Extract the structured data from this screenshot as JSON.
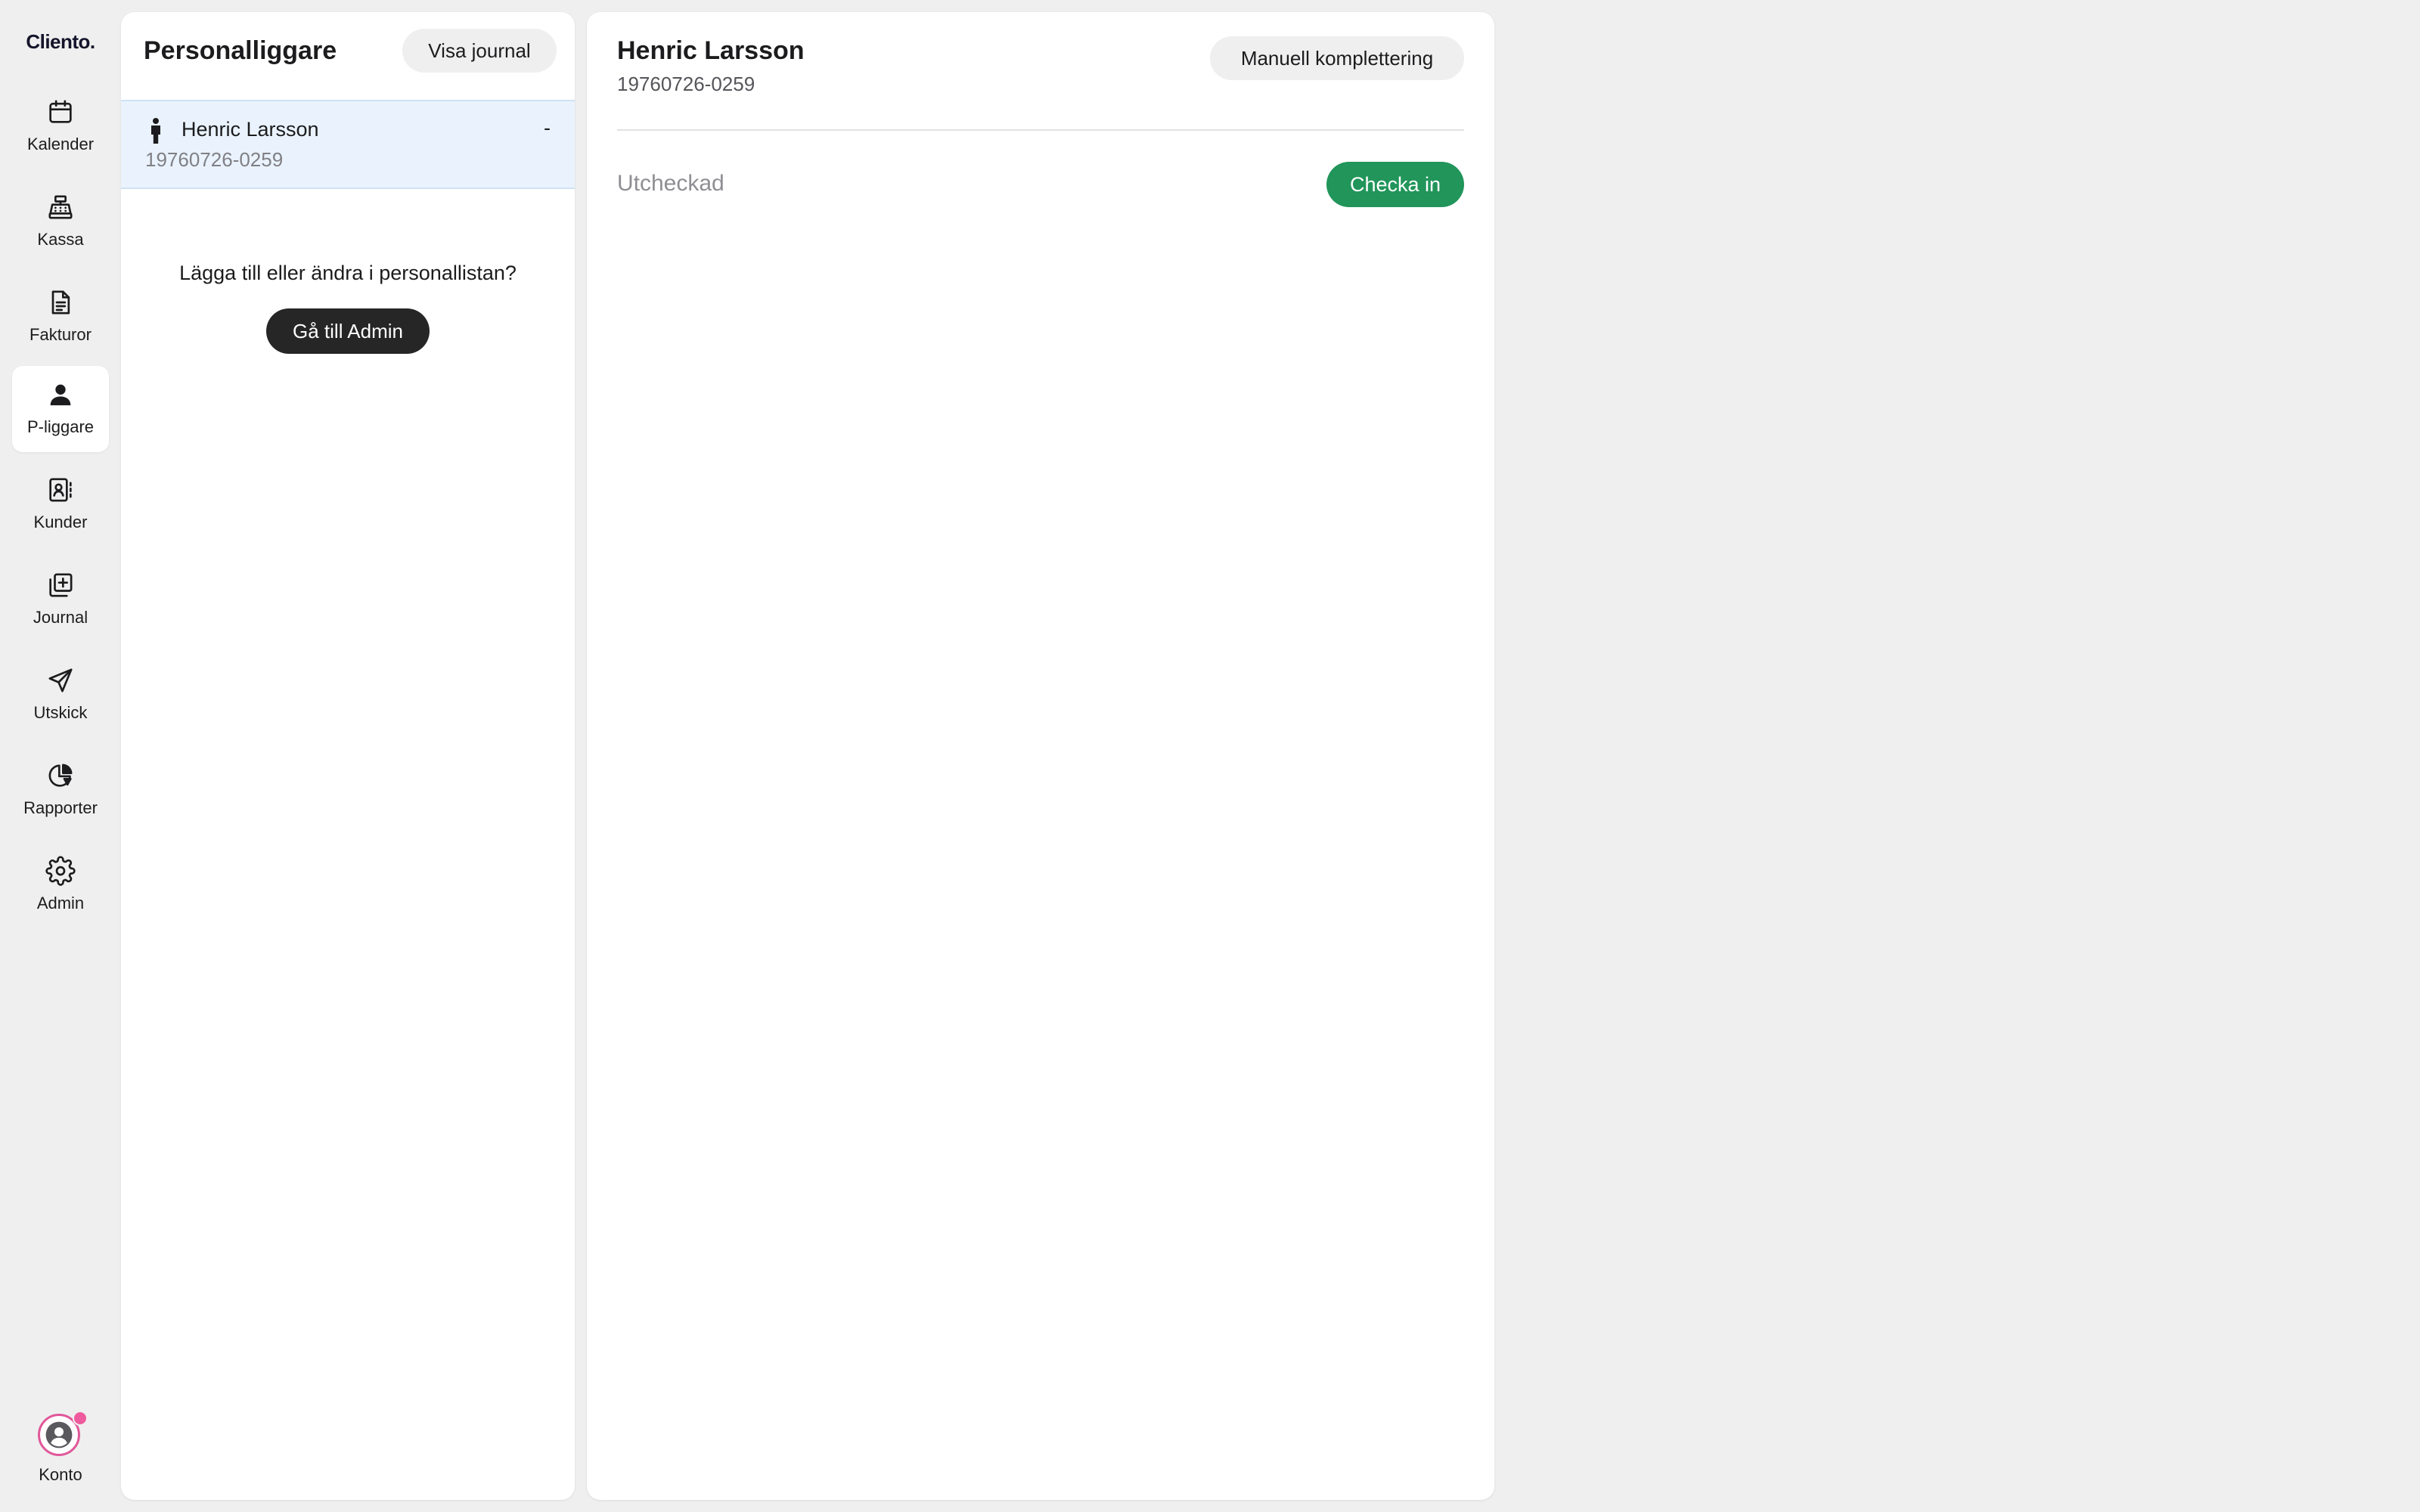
{
  "app": {
    "logo_text": "Cliento."
  },
  "sidebar": {
    "items": [
      {
        "label": "Kalender",
        "icon": "calendar-icon"
      },
      {
        "label": "Kassa",
        "icon": "cash-register-icon"
      },
      {
        "label": "Fakturor",
        "icon": "document-icon"
      },
      {
        "label": "P-liggare",
        "icon": "person-icon",
        "active": true
      },
      {
        "label": "Kunder",
        "icon": "contacts-icon"
      },
      {
        "label": "Journal",
        "icon": "journal-icon"
      },
      {
        "label": "Utskick",
        "icon": "send-icon"
      },
      {
        "label": "Rapporter",
        "icon": "pie-chart-icon"
      },
      {
        "label": "Admin",
        "icon": "gear-icon"
      }
    ],
    "account": {
      "label": "Konto",
      "icon": "user-avatar-icon",
      "has_notification": true
    }
  },
  "left_panel": {
    "title": "Personalliggare",
    "view_journal_label": "Visa journal",
    "employees": [
      {
        "name": "Henric Larsson",
        "id": "19760726-0259",
        "status": "-",
        "selected": true
      }
    ],
    "admin_prompt": "Lägga till eller ändra i personallistan?",
    "admin_button_label": "Gå till Admin"
  },
  "right_panel": {
    "name": "Henric Larsson",
    "id": "19760726-0259",
    "manual_button_label": "Manuell komplettering",
    "status": "Utcheckad",
    "checkin_button_label": "Checka in"
  },
  "colors": {
    "background": "#efefef",
    "panel": "#ffffff",
    "selected_row": "#eaf3fd",
    "primary_dark": "#262626",
    "checkin_green": "#21955a",
    "notification_pink": "#ef5b9c"
  }
}
